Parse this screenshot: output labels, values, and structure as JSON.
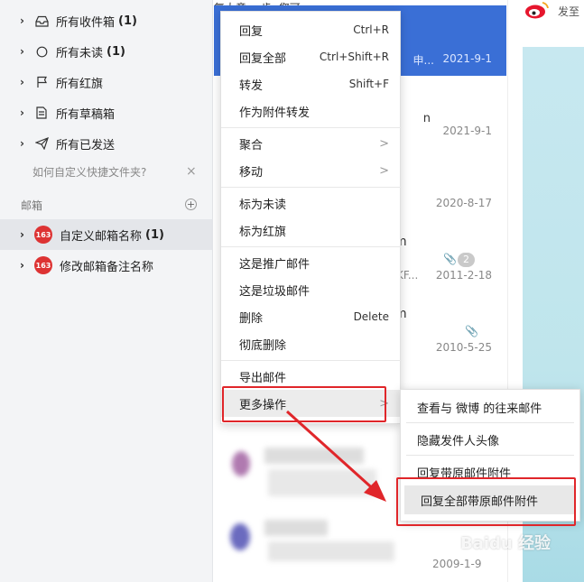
{
  "sidebar": {
    "folders": [
      {
        "label": "所有收件箱",
        "count": "(1)",
        "icon": "inbox-icon"
      },
      {
        "label": "所有未读",
        "count": "(1)",
        "icon": "circle-icon"
      },
      {
        "label": "所有红旗",
        "count": "",
        "icon": "flag-icon"
      },
      {
        "label": "所有草稿箱",
        "count": "",
        "icon": "draft-icon"
      },
      {
        "label": "所有已发送",
        "count": "",
        "icon": "send-icon"
      }
    ],
    "hint": "如何自定义快捷文件夹?",
    "section_title": "邮箱",
    "mailboxes": [
      {
        "label": "自定义邮箱名称",
        "count": "(1)",
        "badge": "163"
      },
      {
        "label": "修改邮箱备注名称",
        "count": "",
        "badge": "163"
      }
    ]
  },
  "maillist": {
    "items": [
      {
        "date": "2021-9-1",
        "trunc": "申..."
      },
      {
        "date": "2021-9-1",
        "trunc": "n"
      },
      {
        "date": "2020-8-17",
        "trunc": ""
      },
      {
        "date": "2011-2-18",
        "trunc": "m",
        "trunc2": "KF...",
        "count": "2"
      },
      {
        "date": "2010-5-25",
        "trunc": "m"
      },
      {
        "date": "",
        "trunc": "复大意"
      },
      {
        "date": "2009-1-9",
        "trunc": "一步, 您可..."
      }
    ]
  },
  "right_panel": {
    "text": "发至"
  },
  "context_menu": {
    "items": [
      {
        "label": "回复",
        "shortcut": "Ctrl+R"
      },
      {
        "label": "回复全部",
        "shortcut": "Ctrl+Shift+R"
      },
      {
        "label": "转发",
        "shortcut": "Shift+F"
      },
      {
        "label": "作为附件转发",
        "shortcut": ""
      },
      {
        "label": "聚合",
        "shortcut": ">"
      },
      {
        "label": "移动",
        "shortcut": ">"
      },
      {
        "label": "标为未读",
        "shortcut": ""
      },
      {
        "label": "标为红旗",
        "shortcut": ""
      },
      {
        "label": "这是推广邮件",
        "shortcut": ""
      },
      {
        "label": "这是垃圾邮件",
        "shortcut": ""
      },
      {
        "label": "删除",
        "shortcut": "Delete"
      },
      {
        "label": "彻底删除",
        "shortcut": ""
      },
      {
        "label": "导出邮件",
        "shortcut": ""
      },
      {
        "label": "更多操作",
        "shortcut": ">"
      }
    ]
  },
  "submenu": {
    "items": [
      {
        "label": "查看与 微博 的往来邮件"
      },
      {
        "label": "隐藏发件人头像"
      },
      {
        "label": "回复带原邮件附件"
      },
      {
        "label": "回复全部带原邮件附件"
      }
    ]
  },
  "watermark": "Baidu 经验",
  "colors": {
    "accent": "#3a6fd6",
    "annotation": "#e0262a"
  }
}
